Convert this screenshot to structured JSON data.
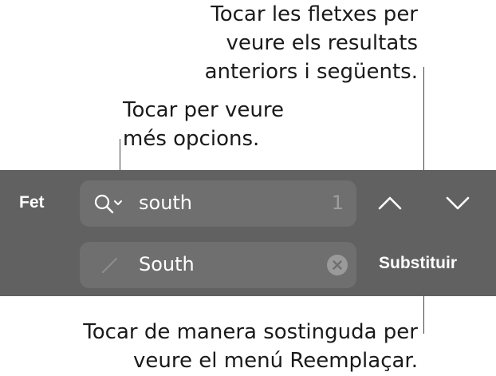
{
  "callouts": {
    "arrows": [
      "Tocar les fletxes per",
      "veure els resultats",
      "anteriors i següents."
    ],
    "options": [
      "Tocar per veure",
      "més opcions."
    ],
    "replace": [
      "Tocar de manera sostinguda per",
      "veure el menú Reemplaçar."
    ]
  },
  "toolbar": {
    "done_label": "Fet",
    "search": {
      "value": "south",
      "match_count": "1",
      "icon": "magnifier-with-chevron-icon"
    },
    "replace": {
      "value": "South",
      "icon": "pencil-icon",
      "clear_icon": "clear-circle-x-icon"
    },
    "previous_icon": "chevron-up-icon",
    "next_icon": "chevron-down-icon",
    "replace_label": "Substituir"
  },
  "colors": {
    "toolbar_bg": "#616161",
    "field_bg": "#6f6f6f",
    "text_light": "#ffffff",
    "text_muted": "#9e9e9e",
    "callout_text": "#1a1a1a",
    "leader_line": "#444444"
  }
}
